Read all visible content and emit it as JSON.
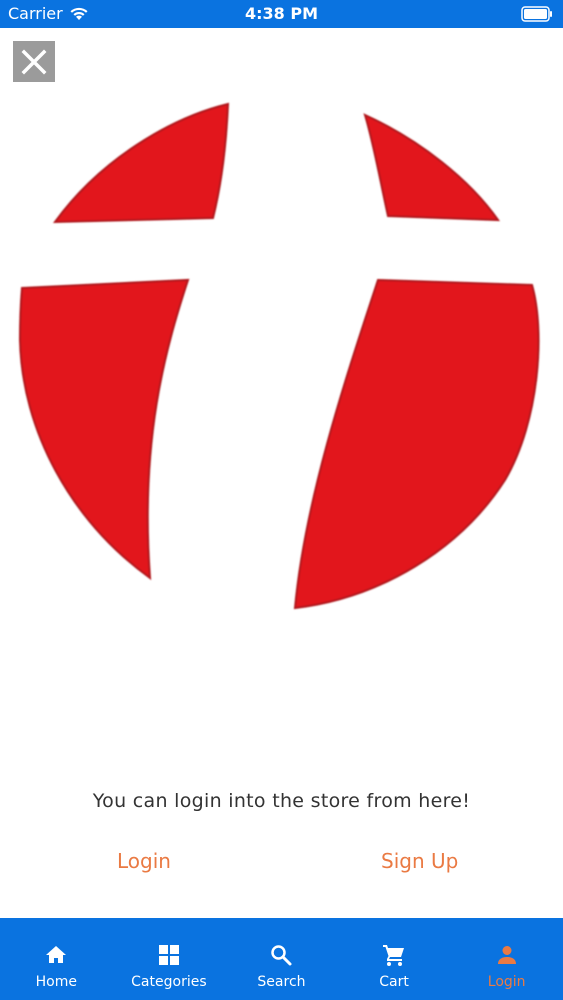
{
  "status_bar": {
    "carrier": "Carrier",
    "time": "4:38 PM"
  },
  "colors": {
    "brand_blue": "#0a73e0",
    "accent_orange": "#ea7a43",
    "logo_red": "#e2141c",
    "close_button_gray": "#9b9b9b"
  },
  "icons": {
    "close": "close-icon",
    "logo": "store-logo",
    "tabs": [
      "home-icon",
      "categories-icon",
      "search-icon",
      "cart-icon",
      "person-icon"
    ]
  },
  "main": {
    "prompt": "You can login into the store from here!",
    "login_label": "Login",
    "signup_label": "Sign Up"
  },
  "tab_bar": {
    "active_tab": "Login",
    "tabs": [
      {
        "label": "Home"
      },
      {
        "label": "Categories"
      },
      {
        "label": "Search"
      },
      {
        "label": "Cart"
      },
      {
        "label": "Login"
      }
    ]
  }
}
